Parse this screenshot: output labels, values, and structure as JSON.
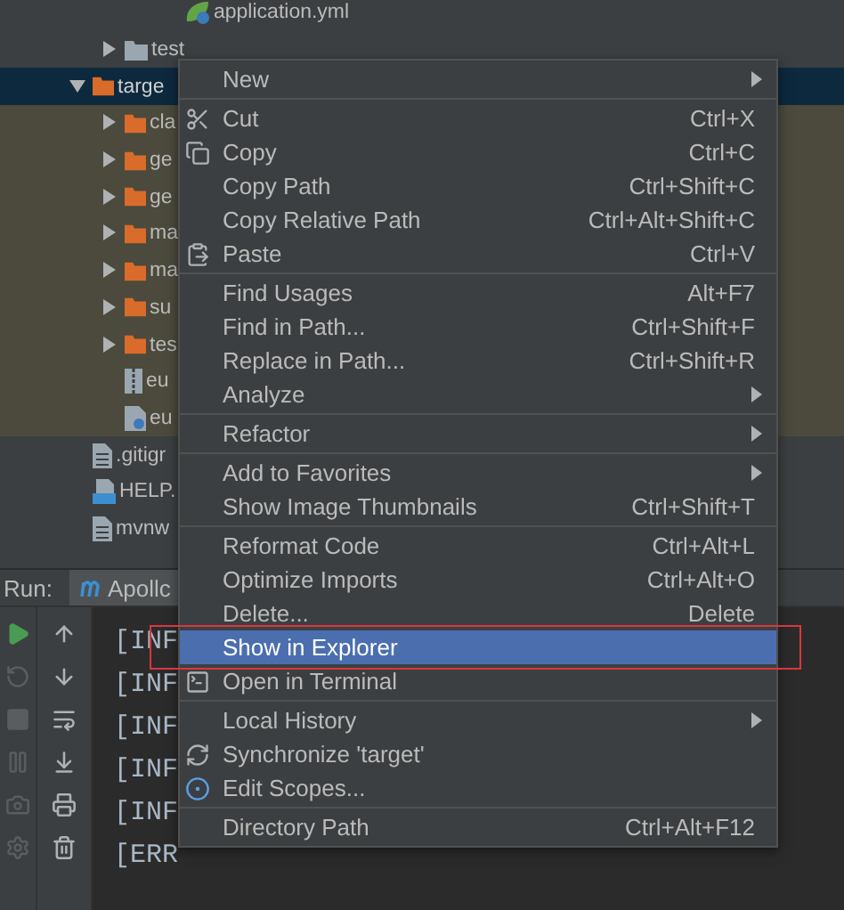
{
  "tree_above": [
    {
      "label": "application.yml",
      "kind": "yaml"
    },
    {
      "label": "test",
      "kind": "folder",
      "expanded": false
    }
  ],
  "tree": [
    {
      "label": "targe",
      "kind": "folder",
      "expanded": true,
      "selected": true,
      "excluded": true,
      "children": [
        {
          "label": "cla",
          "kind": "folder",
          "expanded": false,
          "selected": false
        },
        {
          "label": "ge",
          "kind": "folder",
          "expanded": false,
          "selected": false
        },
        {
          "label": "ge",
          "kind": "folder",
          "expanded": false,
          "selected": false
        },
        {
          "label": "ma",
          "kind": "folder",
          "expanded": false,
          "selected": false
        },
        {
          "label": "ma",
          "kind": "folder",
          "expanded": false,
          "selected": false
        },
        {
          "label": "su",
          "kind": "folder",
          "expanded": false,
          "selected": false
        },
        {
          "label": "tes",
          "kind": "folder",
          "expanded": false,
          "selected": false
        },
        {
          "label": "eu",
          "kind": "archive",
          "selected": false
        },
        {
          "label": "eu",
          "kind": "config",
          "selected": false
        }
      ]
    },
    {
      "label": ".gitigr",
      "kind": "text",
      "selected": false
    },
    {
      "label": "HELP.",
      "kind": "markdown",
      "selected": false
    },
    {
      "label": "mvnw",
      "kind": "text",
      "selected": false
    }
  ],
  "run_panel": {
    "title": "Run:",
    "tab": "Apollc",
    "console_lines": [
      "[INF",
      "[INF",
      "[INF",
      "[INF",
      "[INF",
      "[ERR"
    ]
  },
  "context_menu": {
    "groups": [
      [
        {
          "label": "New",
          "submenu": true,
          "selected": false
        }
      ],
      [
        {
          "label": "Cut",
          "kind": "cut",
          "shortcut": "Ctrl+X",
          "selected": false
        },
        {
          "label": "Copy",
          "kind": "copy",
          "shortcut": "Ctrl+C",
          "selected": false
        },
        {
          "label": "Copy Path",
          "shortcut": "Ctrl+Shift+C",
          "selected": false
        },
        {
          "label": "Copy Relative Path",
          "shortcut": "Ctrl+Alt+Shift+C",
          "selected": false
        },
        {
          "label": "Paste",
          "kind": "paste",
          "shortcut": "Ctrl+V",
          "selected": false
        }
      ],
      [
        {
          "label": "Find Usages",
          "shortcut": "Alt+F7",
          "selected": false
        },
        {
          "label": "Find in Path...",
          "shortcut": "Ctrl+Shift+F",
          "selected": false
        },
        {
          "label": "Replace in Path...",
          "shortcut": "Ctrl+Shift+R",
          "selected": false
        },
        {
          "label": "Analyze",
          "submenu": true,
          "selected": false
        }
      ],
      [
        {
          "label": "Refactor",
          "submenu": true,
          "selected": false
        }
      ],
      [
        {
          "label": "Add to Favorites",
          "submenu": true,
          "selected": false
        },
        {
          "label": "Show Image Thumbnails",
          "shortcut": "Ctrl+Shift+T",
          "selected": false
        }
      ],
      [
        {
          "label": "Reformat Code",
          "shortcut": "Ctrl+Alt+L",
          "selected": false
        },
        {
          "label": "Optimize Imports",
          "shortcut": "Ctrl+Alt+O",
          "selected": false
        },
        {
          "label": "Delete...",
          "shortcut": "Delete",
          "selected": false
        },
        {
          "label": "Show in Explorer",
          "selected": true,
          "highlighted": true
        },
        {
          "label": "Open in Terminal",
          "kind": "terminal",
          "selected": false
        }
      ],
      [
        {
          "label": "Local History",
          "submenu": true,
          "selected": false
        },
        {
          "label": "Synchronize 'target'",
          "kind": "sync",
          "selected": false
        },
        {
          "label": "Edit Scopes...",
          "kind": "scope",
          "selected": false
        }
      ],
      [
        {
          "label": "Directory Path",
          "shortcut": "Ctrl+Alt+F12",
          "selected": false
        }
      ]
    ]
  }
}
